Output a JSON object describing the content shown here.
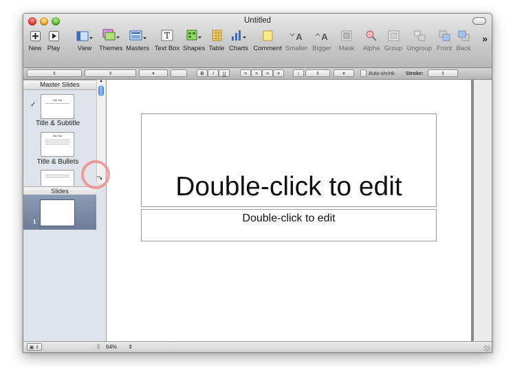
{
  "window": {
    "title": "Untitled"
  },
  "toolbar": {
    "items": [
      {
        "label": "New",
        "icon": "new-slide-icon"
      },
      {
        "label": "Play",
        "icon": "play-icon"
      },
      {
        "label": "View",
        "icon": "view-icon"
      },
      {
        "label": "Themes",
        "icon": "themes-icon"
      },
      {
        "label": "Masters",
        "icon": "masters-icon"
      },
      {
        "label": "Text Box",
        "icon": "text-box-icon"
      },
      {
        "label": "Shapes",
        "icon": "shapes-icon"
      },
      {
        "label": "Table",
        "icon": "table-icon"
      },
      {
        "label": "Charts",
        "icon": "charts-icon"
      },
      {
        "label": "Comment",
        "icon": "comment-icon"
      },
      {
        "label": "Smaller",
        "icon": "smaller-text-icon"
      },
      {
        "label": "Bigger",
        "icon": "bigger-text-icon"
      },
      {
        "label": "Mask",
        "icon": "mask-icon"
      },
      {
        "label": "Alpha",
        "icon": "alpha-icon"
      },
      {
        "label": "Group",
        "icon": "group-icon"
      },
      {
        "label": "Ungroup",
        "icon": "ungroup-icon"
      },
      {
        "label": "Front",
        "icon": "front-icon"
      },
      {
        "label": "Back",
        "icon": "back-icon"
      }
    ],
    "overflow": "»"
  },
  "formatbar": {
    "bold": "B",
    "italic": "I",
    "underline": "U",
    "auto_shrink": "Auto-shrink",
    "stroke_label": "Stroke:"
  },
  "sidebar": {
    "master_header": "Master Slides",
    "masters": [
      {
        "label": "Title & Subtitle",
        "thumb_title": "Title Text",
        "checked": true
      },
      {
        "label": "Title & Bullets",
        "thumb_title": "Title Text",
        "checked": false
      }
    ],
    "slides_header": "Slides",
    "slides": [
      {
        "number": "1"
      }
    ]
  },
  "slide": {
    "title_placeholder": "Double-click to edit",
    "subtitle_placeholder": "Double-click to edit"
  },
  "statusbar": {
    "zoom": "64%"
  },
  "colors": {
    "selection": "#6d7c98",
    "highlight_ring": "#f48080"
  }
}
